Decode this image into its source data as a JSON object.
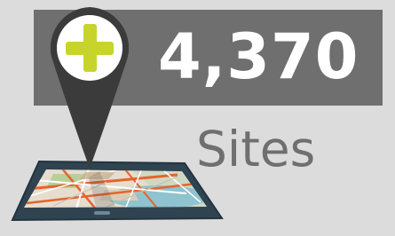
{
  "stat": {
    "value": "4,370",
    "label": "Sites"
  },
  "icons": {
    "pin": "map-pin-icon",
    "plus": "plus-icon",
    "phone": "smartphone-map-icon"
  },
  "colors": {
    "background": "#dcdcdc",
    "banner": "#6f6f6f",
    "value_text": "#ffffff",
    "label_text": "#6f6f6f",
    "pin": "#3b3b3b",
    "plus": "#c6d42b",
    "phone_body": "#2f4350",
    "map_land": "#e6ddcf",
    "map_road_orange": "#e5642c",
    "map_road_white": "#ffffff",
    "map_water": "#8ec3cf",
    "map_green": "#b7cf9a"
  }
}
